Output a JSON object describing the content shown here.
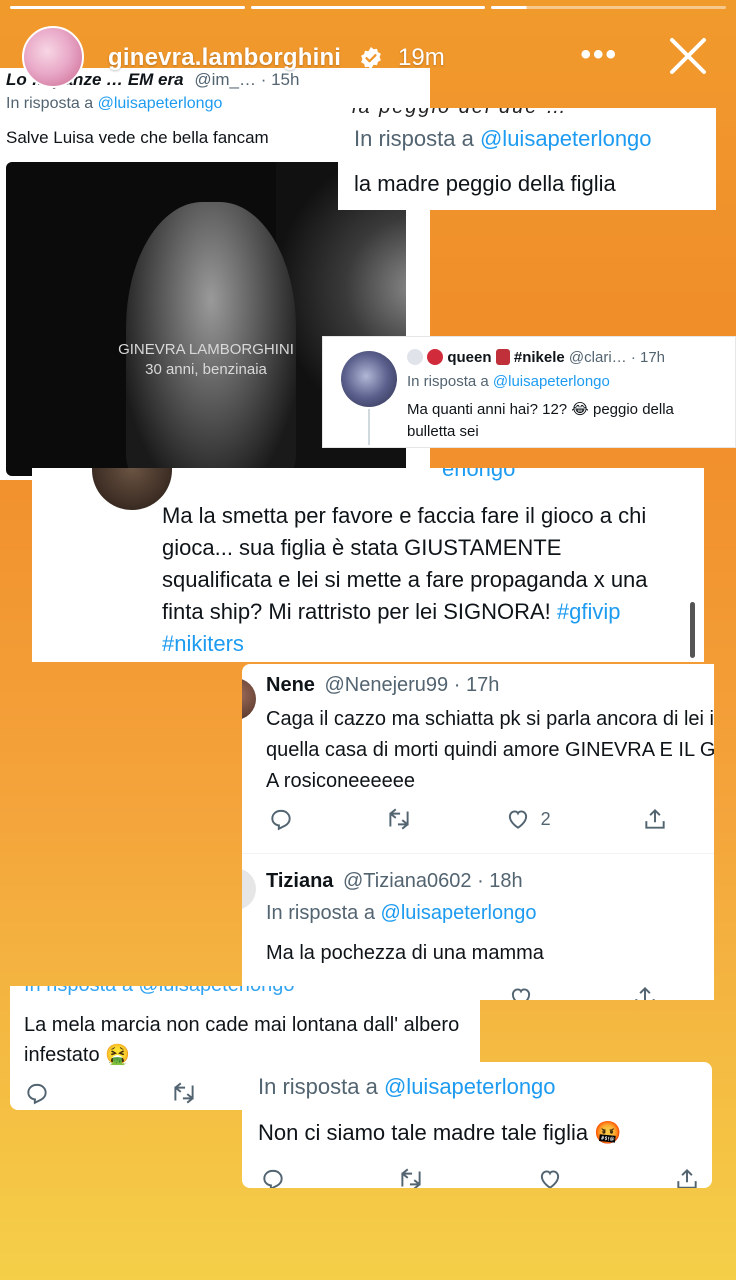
{
  "story": {
    "username": "ginevra.lamborghini",
    "time": "19m",
    "more_label": "•••"
  },
  "tweet1": {
    "name": "Lo … panze … EM era",
    "handle_time": "@im_… · 15h",
    "reply_prefix": "In risposta a",
    "reply_to": "@luisapeterlongo",
    "text": "Salve Luisa vede che bella fancam",
    "video_caption_line1": "GINEVRA LAMBORGHINI",
    "video_caption_line2": "30 anni, benzinaia"
  },
  "tweet2": {
    "top_fragment": "la peggio dei due …",
    "reply_prefix": "In risposta a",
    "reply_to": "@luisapeterlongo",
    "text": "la madre peggio della figlia"
  },
  "tweet3": {
    "name": "queen",
    "tag": "#nikele",
    "handle_time": "@clari… · 17h",
    "reply_prefix": "In risposta a",
    "reply_to": "@luisapeterlongo",
    "text": "Ma quanti anni hai? 12? 😂 peggio della bulletta sei"
  },
  "tweet4": {
    "top_fragment": "erlongo",
    "text_plain": "Ma la smetta  per favore e faccia fare il gioco a chi gioca... sua figlia è stata GIUSTAMENTE squalificata e lei si mette a fare propaganda x una finta ship? Mi rattristo per lei SIGNORA!",
    "hashtags": "#gfivip #nikiters"
  },
  "tweet5": {
    "name": "Nene",
    "handle_time": "@Nenejeru99 · 17h",
    "text": "Caga il cazzo ma schiatta pk si parla ancora di lei in quella casa di morti quindi amore GINEVRA E IL GF  A rosiconeeeeee",
    "likes": "2"
  },
  "tweet6": {
    "name": "Tiziana",
    "handle_time": "@Tiziana0602 · 18h",
    "reply_prefix": "In risposta a",
    "reply_to": "@luisapeterlongo",
    "text": "Ma la pochezza di una mamma"
  },
  "tweet7": {
    "top_fragment": "In risposta a @luisapeterlongo",
    "text": "La mela marcia non cade mai lontana dall' albero infestato 🤮"
  },
  "tweet8": {
    "reply_prefix": "In risposta a",
    "reply_to": "@luisapeterlongo",
    "text": "Non ci siamo tale madre tale figlia 🤬"
  },
  "colors": {
    "twitter_blue": "#1d9bf0",
    "text_dark": "#0f1419",
    "text_grey": "#536471",
    "bg_top": "#f19a2c",
    "bg_bottom": "#f5cf48"
  }
}
